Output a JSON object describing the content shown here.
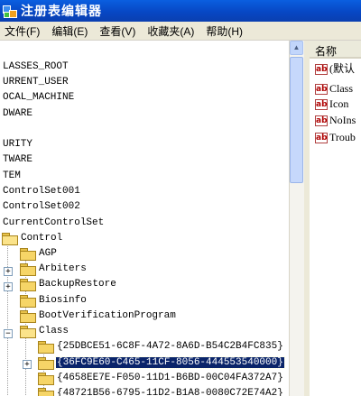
{
  "window": {
    "title": "注册表编辑器",
    "icon": "registry-icon"
  },
  "menu": [
    {
      "label": "文件(F)"
    },
    {
      "label": "编辑(E)"
    },
    {
      "label": "查看(V)"
    },
    {
      "label": "收藏夹(A)"
    },
    {
      "label": "帮助(H)"
    }
  ],
  "tree": {
    "items": [
      {
        "label": "LASSES_ROOT"
      },
      {
        "label": "URRENT_USER"
      },
      {
        "label": "OCAL_MACHINE"
      },
      {
        "label": "DWARE"
      },
      {
        "label": ""
      },
      {
        "label": "URITY"
      },
      {
        "label": "TWARE"
      },
      {
        "label": "TEM"
      },
      {
        "label": "ControlSet001"
      },
      {
        "label": "ControlSet002"
      },
      {
        "label": "CurrentControlSet"
      },
      {
        "label": "Control"
      },
      {
        "label": "AGP"
      },
      {
        "label": "Arbiters"
      },
      {
        "label": "BackupRestore"
      },
      {
        "label": "Biosinfo"
      },
      {
        "label": "BootVerificationProgram"
      },
      {
        "label": "Class"
      },
      {
        "label": "{25DBCE51-6C8F-4A72-8A6D-B54C2B4FC835}"
      },
      {
        "label": "{36FC9E60-C465-11CF-8056-444553540000}"
      },
      {
        "label": "{4658EE7E-F050-11D1-B6BD-00C04FA372A7}"
      },
      {
        "label": "{48721B56-6795-11D2-B1A8-0080C72E74A2}"
      }
    ]
  },
  "values_pane": {
    "header": "名称",
    "rows": [
      {
        "icon": "string-value-icon",
        "label": "(默认"
      },
      {
        "icon": "string-value-icon",
        "label": "Class"
      },
      {
        "icon": "string-value-icon",
        "label": "Icon"
      },
      {
        "icon": "string-value-icon",
        "label": "NoIns"
      },
      {
        "icon": "string-value-icon",
        "label": "Troub"
      }
    ]
  }
}
